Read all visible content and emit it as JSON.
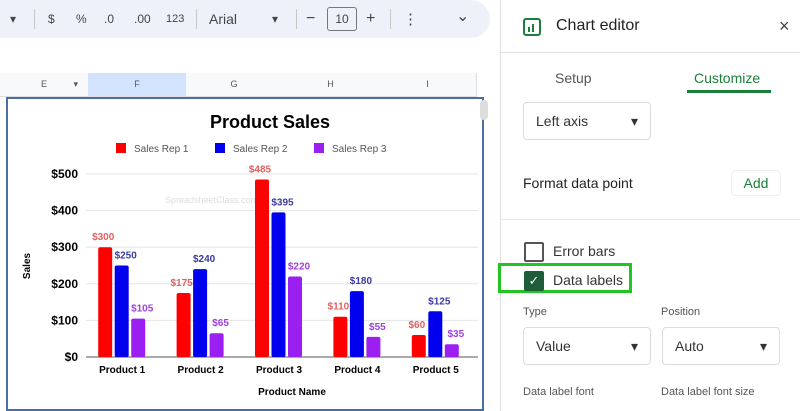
{
  "toolbar": {
    "currency": "$",
    "percent": "%",
    "decrease_decimal": ".0",
    "increase_decimal": ".00",
    "format_123": "123",
    "font": "Arial",
    "font_size": "10",
    "minus": "−",
    "plus": "+",
    "more": "⋮",
    "collapse": "⌄"
  },
  "columns": [
    "E",
    "F",
    "G",
    "H",
    "I"
  ],
  "chart_editor": {
    "title": "Chart editor",
    "close": "×",
    "tabs": [
      "Setup",
      "Customize"
    ],
    "active_tab": "Customize",
    "axis_select": "Left axis",
    "format_data_point": "Format data point",
    "add_label": "Add",
    "error_bars": {
      "label": "Error bars",
      "checked": false
    },
    "data_labels": {
      "label": "Data labels",
      "checked": true
    },
    "type_label": "Type",
    "type_value": "Value",
    "position_label": "Position",
    "position_value": "Auto",
    "font_label": "Data label font",
    "font_size_label": "Data label font size",
    "highlight_color": "#22c522",
    "accent": "#188038"
  },
  "chart_data": {
    "type": "bar",
    "title": "Product Sales",
    "xlabel": "Product Name",
    "ylabel": "Sales",
    "watermark": "SpreadsheetClass.com",
    "categories": [
      "Product 1",
      "Product 2",
      "Product 3",
      "Product 4",
      "Product 5"
    ],
    "series": [
      {
        "name": "Sales Rep 1",
        "color": "#ff0000",
        "label_color": "#e06060",
        "values": [
          300,
          175,
          485,
          110,
          60
        ],
        "labels": [
          "$300",
          "$175",
          "$485",
          "$110",
          "$60"
        ]
      },
      {
        "name": "Sales Rep 2",
        "color": "#0000ee",
        "label_color": "#3a3aa0",
        "values": [
          250,
          240,
          395,
          180,
          125
        ],
        "labels": [
          "$250",
          "$240",
          "$395",
          "$180",
          "$125"
        ]
      },
      {
        "name": "Sales Rep 3",
        "color": "#9b1ff0",
        "label_color": "#a040e0",
        "values": [
          105,
          65,
          220,
          55,
          35
        ],
        "labels": [
          "$105",
          "$65",
          "$220",
          "$55",
          "$35"
        ]
      }
    ],
    "yticks": [
      "$0",
      "$100",
      "$200",
      "$300",
      "$400",
      "$500"
    ],
    "ylim": [
      0,
      500
    ],
    "grid": true,
    "legend": "top"
  }
}
